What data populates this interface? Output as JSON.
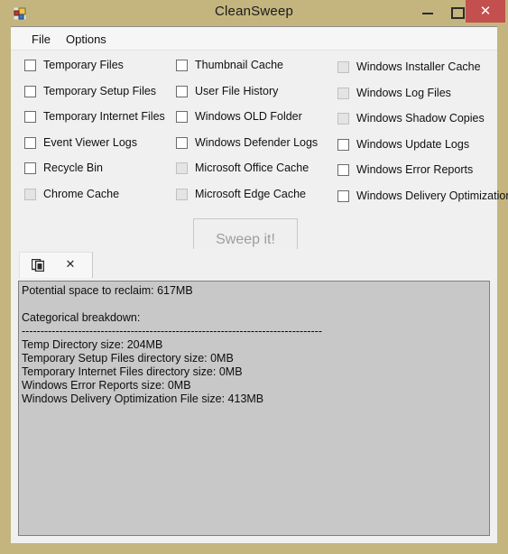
{
  "window": {
    "title": "CleanSweep",
    "app_icon": "app-squares-icon",
    "controls": {
      "minimize": "minimize-icon",
      "maximize": "maximize-icon",
      "close": "✕"
    },
    "accent_titlebar": "#c4b57e",
    "accent_close": "#c44f4f"
  },
  "menu": {
    "items": [
      {
        "label": "File"
      },
      {
        "label": "Options"
      }
    ]
  },
  "options": {
    "columns": [
      {
        "items": [
          {
            "label": "Temporary Files",
            "checked": false,
            "enabled": true
          },
          {
            "label": "Temporary Setup Files",
            "checked": false,
            "enabled": true
          },
          {
            "label": "Temporary Internet Files",
            "checked": false,
            "enabled": true
          },
          {
            "label": "Event Viewer Logs",
            "checked": false,
            "enabled": true
          },
          {
            "label": "Recycle Bin",
            "checked": false,
            "enabled": true
          },
          {
            "label": "Chrome Cache",
            "checked": false,
            "enabled": false
          }
        ]
      },
      {
        "items": [
          {
            "label": "Thumbnail Cache",
            "checked": false,
            "enabled": true
          },
          {
            "label": "User File History",
            "checked": false,
            "enabled": true
          },
          {
            "label": "Windows OLD Folder",
            "checked": false,
            "enabled": true
          },
          {
            "label": "Windows Defender Logs",
            "checked": false,
            "enabled": true
          },
          {
            "label": "Microsoft Office Cache",
            "checked": false,
            "enabled": false
          },
          {
            "label": "Microsoft Edge Cache",
            "checked": false,
            "enabled": false
          }
        ]
      },
      {
        "items": [
          {
            "label": "Windows Installer Cache",
            "checked": false,
            "enabled": false
          },
          {
            "label": "Windows Log Files",
            "checked": false,
            "enabled": false
          },
          {
            "label": "Windows Shadow Copies",
            "checked": false,
            "enabled": false
          },
          {
            "label": "Windows Update Logs",
            "checked": false,
            "enabled": true
          },
          {
            "label": "Windows Error Reports",
            "checked": false,
            "enabled": true
          },
          {
            "label": "Windows Delivery Optimization",
            "checked": false,
            "enabled": true
          }
        ]
      }
    ]
  },
  "action": {
    "sweep_label": "Sweep it!",
    "sweep_enabled": false
  },
  "tabs": {
    "items": [
      {
        "copy_icon": "copy-icon",
        "close_label": "✕"
      }
    ]
  },
  "output": {
    "lines": [
      "Potential space to reclaim: 617MB",
      "",
      "Categorical breakdown:",
      "--------------------------------------------------------------------------------",
      "Temp Directory size: 204MB",
      "Temporary Setup Files directory size: 0MB",
      "Temporary Internet Files directory size: 0MB",
      "Windows Error Reports size: 0MB",
      "Windows Delivery Optimization File size: 413MB"
    ]
  }
}
